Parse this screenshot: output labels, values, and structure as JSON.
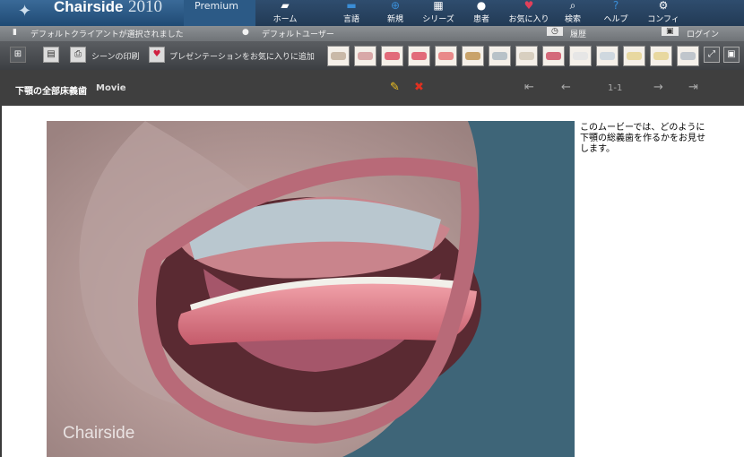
{
  "brand": {
    "name": "Chairside",
    "year": "2010",
    "edition": "Premium"
  },
  "nav": [
    {
      "label": "ホーム",
      "icon": "chair-icon"
    },
    {
      "label": "言語",
      "icon": "book-icon"
    },
    {
      "label": "新規",
      "icon": "new-icon"
    },
    {
      "label": "シリーズ",
      "icon": "film-icon"
    },
    {
      "label": "患者",
      "icon": "user-icon"
    },
    {
      "label": "お気に入り",
      "icon": "heart-icon"
    },
    {
      "label": "検索",
      "icon": "search-icon"
    },
    {
      "label": "ヘルプ",
      "icon": "help-icon"
    },
    {
      "label": "コンフィグ",
      "icon": "gear-icon"
    }
  ],
  "status": {
    "client": "デフォルトクライアントが選択されました",
    "user": "デフォルトユーザー",
    "history": "履歴",
    "login": "ログイン"
  },
  "toolbar": {
    "print_scene": "シーンの印刷",
    "add_favorite": "プレゼンテーションをお気に入りに追加"
  },
  "title": {
    "text": "下顎の全部床義歯",
    "type": "Movie",
    "page": "1-1"
  },
  "video": {
    "watermark": "Chairside"
  },
  "description": "このムービーでは、どのように下顎の総義歯を作るかをお見せします。",
  "colors": {
    "topbar": "#2f4d6e",
    "accent": "#1f4a74",
    "titlebar": "#3f3f3f",
    "video_bg": "#3e6578"
  }
}
